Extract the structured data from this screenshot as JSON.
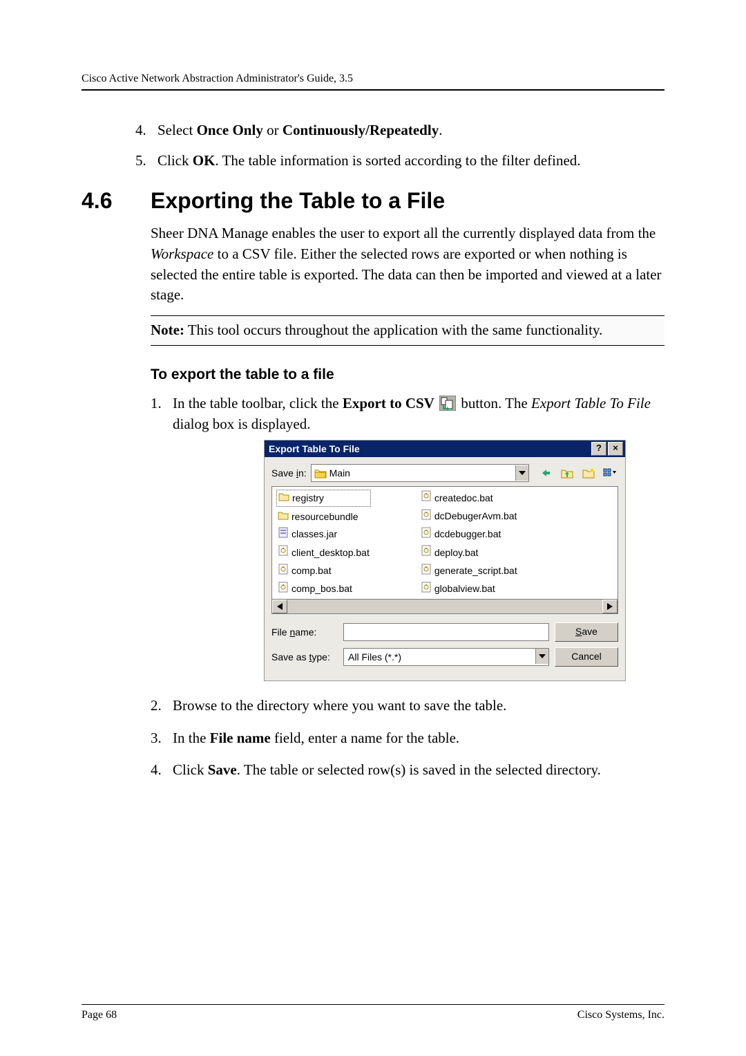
{
  "running_head": "Cisco Active Network Abstraction Administrator's Guide, 3.5",
  "steps_a": {
    "s4_pre": "Select ",
    "s4_b1": "Once Only",
    "s4_mid": " or ",
    "s4_b2": "Continuously/Repeatedly",
    "s4_post": ".",
    "s5_pre": "Click ",
    "s5_b": "OK",
    "s5_post": ". The table information is sorted according to the filter defined."
  },
  "section": {
    "num": "4.6",
    "title": "Exporting the Table to a File"
  },
  "para1_a": "Sheer DNA Manage enables the user to export all the currently displayed data from the ",
  "para1_i": "Workspace",
  "para1_b": " to a CSV file. Either the selected rows are exported or when nothing is selected the entire table is exported. The data can then be imported and viewed at a later stage.",
  "note_b": "Note:",
  "note_t": " This tool occurs throughout the application with the same functionality.",
  "subhead": "To export the table to a file",
  "steps_b": {
    "s1_a": "In the table toolbar, click the ",
    "s1_b": "Export to CSV",
    "s1_c": " button. The ",
    "s1_i": "Export Table To File",
    "s1_d": " dialog box is displayed.",
    "s2": "Browse to the directory where you want to save the table.",
    "s3_a": "In the ",
    "s3_b": "File name",
    "s3_c": " field, enter a name for the table.",
    "s4_a": "Click ",
    "s4_b": "Save",
    "s4_c": ". The table or selected row(s) is saved in the selected directory."
  },
  "dialog": {
    "title": "Export Table To File",
    "save_in_label": "Save in:",
    "save_in_value": "Main",
    "files_col1": [
      "registry",
      "resourcebundle",
      "classes.jar",
      "client_desktop.bat",
      "comp.bat",
      "comp_bos.bat"
    ],
    "files_col2": [
      "createdoc.bat",
      "dcDebugerAvm.bat",
      "dcdebugger.bat",
      "deploy.bat",
      "generate_script.bat",
      "globalview.bat"
    ],
    "file_name_label": "File name:",
    "save_as_type_label": "Save as type:",
    "save_as_type_value": "All Files (*.*)",
    "save_btn": "Save",
    "cancel_btn": "Cancel"
  },
  "footer": {
    "left": "Page 68",
    "right": "Cisco Systems, Inc."
  }
}
